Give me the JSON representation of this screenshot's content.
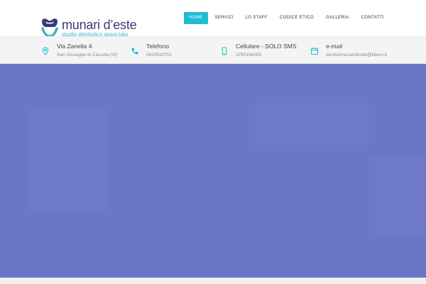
{
  "brand": {
    "name": "munari d’este",
    "subtitle": "studio dentistico associato",
    "primary_color": "#3a3a7a",
    "accent_color": "#3fb1c5",
    "logo_icon": "tooth-logo-icon"
  },
  "nav": {
    "items": [
      {
        "label": "HOME",
        "active": true
      },
      {
        "label": "SERVIZI",
        "active": false
      },
      {
        "label": "LO STAFF",
        "active": false
      },
      {
        "label": "CODICE ETICO",
        "active": false
      },
      {
        "label": "GALLERIA",
        "active": false
      },
      {
        "label": "CONTATTI",
        "active": false
      }
    ],
    "active_color": "#1fbcd2"
  },
  "contacts": [
    {
      "icon": "location-pin-icon",
      "title": "Via Zanella 4",
      "value": "San Giuseppe di Cassola (VI)"
    },
    {
      "icon": "phone-icon",
      "title": "Telefono",
      "value": "0424510751"
    },
    {
      "icon": "mobile-phone-icon",
      "title": "Cellulare - SOLO SMS",
      "value": "3755166555"
    },
    {
      "icon": "calendar-icon",
      "title": "e-mail",
      "value": "dentistimunaridestte@libero.it"
    }
  ],
  "hero": {
    "background_color": "#6a76c6"
  }
}
